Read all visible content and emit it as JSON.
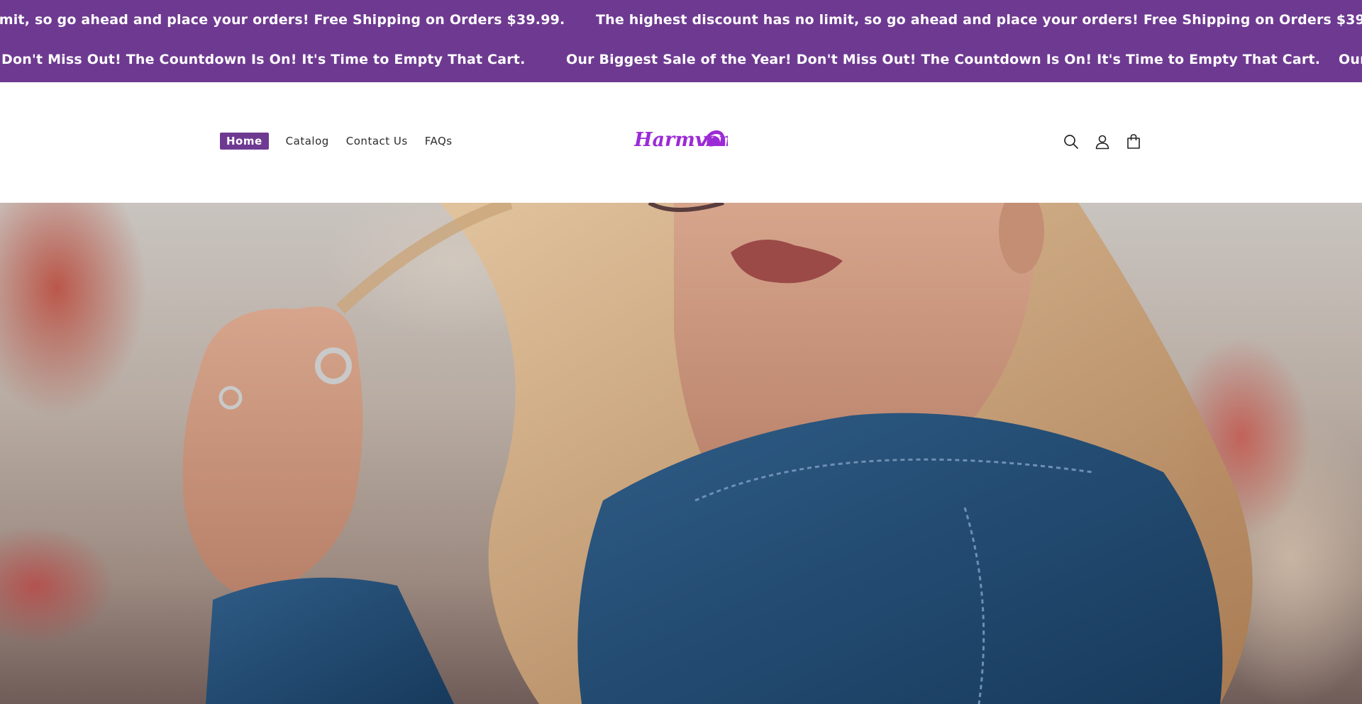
{
  "announcements": {
    "row1": {
      "text_a": "imit, so go ahead and place your orders!  Free Shipping on Orders $39.99.",
      "text_b": "The highest discount has no limit, so go ahead and place your orders!  Free Shipping on Orders $39.99."
    },
    "row2": {
      "text_a": "Don't Miss Out!  The Countdown Is On! It's Time to Empty That Cart.",
      "text_b": "Our Biggest Sale of the Year! Don't Miss Out!  The Countdown Is On! It's Time to Empty That Cart.",
      "text_c": "Our"
    }
  },
  "header": {
    "nav": [
      {
        "label": "Home",
        "active": true
      },
      {
        "label": "Catalog",
        "active": false
      },
      {
        "label": "Contact Us",
        "active": false
      },
      {
        "label": "FAQs",
        "active": false
      }
    ],
    "logo_text": "Harmven",
    "icons": [
      "search-icon",
      "account-icon",
      "cart-icon"
    ]
  },
  "hero": {
    "image_subject": "woman in denim jacket pulling hair"
  },
  "colors": {
    "brand": "#6e3a91",
    "logo": "#9b2bd6",
    "text": "#2b2b2b",
    "white": "#ffffff"
  }
}
